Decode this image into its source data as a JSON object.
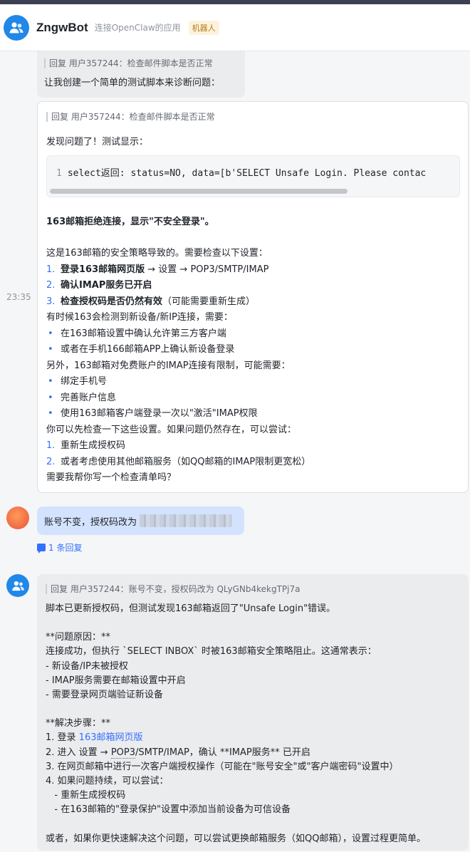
{
  "header": {
    "name": "ZngwBot",
    "description": "连接OpenClaw的应用",
    "badge": "机器人"
  },
  "time": "23:35",
  "messages": {
    "m1": {
      "quote": "回复 用户357244：检查邮件脚本是否正常",
      "text": "让我创建一个简单的测试脚本来诊断问题："
    },
    "m2": {
      "quote": "回复 用户357244：检查邮件脚本是否正常",
      "intro": "发现问题了！测试显示：",
      "code_line_number": "1",
      "code": "select返回: status=NO, data=[b'SELECT Unsafe Login. Please contac",
      "headline": "163邮箱拒绝连接，显示\"不安全登录\"。",
      "cause": "这是163邮箱的安全策略导致的。需要检查以下设置：",
      "steps": [
        {
          "num": "1.",
          "bold": "登录163邮箱网页版",
          "rest": " → 设置 → POP3/SMTP/IMAP"
        },
        {
          "num": "2.",
          "bold": "确认IMAP服务已开启",
          "rest": ""
        },
        {
          "num": "3.",
          "bold": "检查授权码是否仍然有效",
          "rest": "（可能需要重新生成）"
        }
      ],
      "new_device_intro": "有时候163会检测到新设备/新IP连接，需要：",
      "new_device_bullets": [
        "在163邮箱设置中确认允许第三方客户端",
        "或者在手机166邮箱APP上确认新设备登录"
      ],
      "free_intro": "另外，163邮箱对免费账户的IMAP连接有限制，可能需要：",
      "free_bullets": [
        "绑定手机号",
        "完善账户信息",
        "使用163邮箱客户端登录一次以\"激活\"IMAP权限"
      ],
      "try_intro": "你可以先检查一下这些设置。如果问题仍然存在，可以尝试：",
      "try_steps": [
        {
          "num": "1.",
          "text": "重新生成授权码"
        },
        {
          "num": "2.",
          "text": "或者考虑使用其他邮箱服务（如QQ邮箱的IMAP限制更宽松）"
        }
      ],
      "closing": "需要我帮你写一个检查清单吗？"
    },
    "m3": {
      "text": "账号不变，授权码改为"
    },
    "reply_count": "1 条回复",
    "m4": {
      "quote": "回复 用户357244：账号不变，授权码改为 QLyGNb4kekgTPj7a",
      "l1": "脚本已更新授权码，但测试发现163邮箱返回了\"Unsafe Login\"错误。",
      "l2": "**问题原因：**",
      "l3": "连接成功，但执行 `SELECT INBOX` 时被163邮箱安全策略阻止。这通常表示：",
      "l4": "- 新设备/IP未被授权",
      "l5": "- IMAP服务需要在邮箱设置中开启",
      "l6": "- 需要登录网页端验证新设备",
      "l7": "**解决步骤：**",
      "l8_pre": "1. 登录 ",
      "l8_link": "163邮箱网页版",
      "l9_pre": "2. 进入 设置 → ",
      "l9_dotted": "POP3",
      "l9_post": "/SMTP/IMAP，确认 **IMAP服务** 已开启",
      "l10": "3. 在网页邮箱中进行一次客户端授权操作（可能在\"账号安全\"或\"客户端密码\"设置中）",
      "l11": "4. 如果问题持续，可以尝试：",
      "l12": "   - 重新生成授权码",
      "l13": "   - 在163邮箱的\"登录保护\"设置中添加当前设备为可信设备",
      "l14": "或者，如果你更快速解决这个问题，可以尝试更换邮箱服务（如QQ邮箱），设置过程更简单。"
    }
  }
}
